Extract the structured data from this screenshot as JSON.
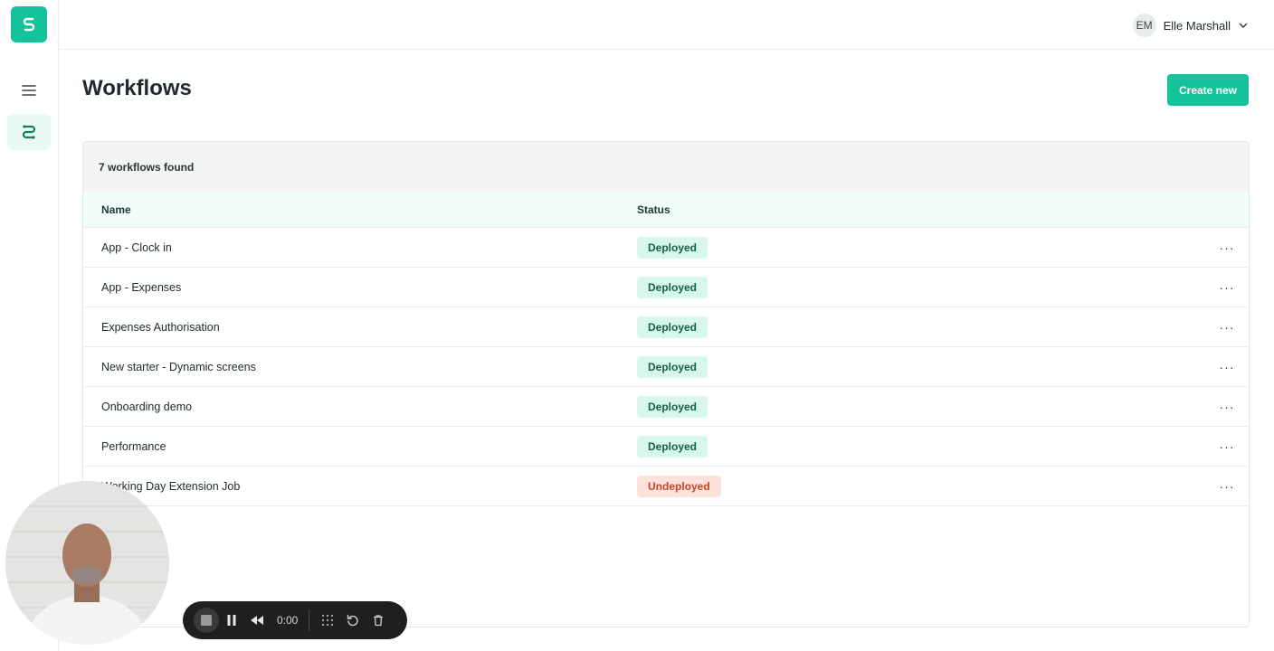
{
  "sidebar": {
    "logo_icon": "brand-s-icon",
    "menu_icon": "hamburger-icon",
    "workflows_icon": "workflow-icon"
  },
  "header": {
    "user": {
      "initials": "EM",
      "name": "Elle Marshall",
      "chevron_icon": "chevron-down-icon"
    }
  },
  "main": {
    "title": "Workflows",
    "create_label": "Create new",
    "count_label": "7 workflows found",
    "columns": {
      "name": "Name",
      "status": "Status"
    },
    "rows": [
      {
        "name": "App - Clock in",
        "status": "Deployed"
      },
      {
        "name": "App - Expenses",
        "status": "Deployed"
      },
      {
        "name": "Expenses Authorisation",
        "status": "Deployed"
      },
      {
        "name": "New starter - Dynamic screens",
        "status": "Deployed"
      },
      {
        "name": "Onboarding demo",
        "status": "Deployed"
      },
      {
        "name": "Performance",
        "status": "Deployed"
      },
      {
        "name": "Working Day Extension Job",
        "status": "Undeployed"
      }
    ],
    "more_label": "···"
  },
  "recorder": {
    "time": "0:00"
  },
  "colors": {
    "brand": "#14c39a",
    "deployed_bg": "#d6f7ea",
    "deployed_text": "#16604a",
    "undeployed_bg": "#fde2dc",
    "undeployed_text": "#c0472a"
  }
}
